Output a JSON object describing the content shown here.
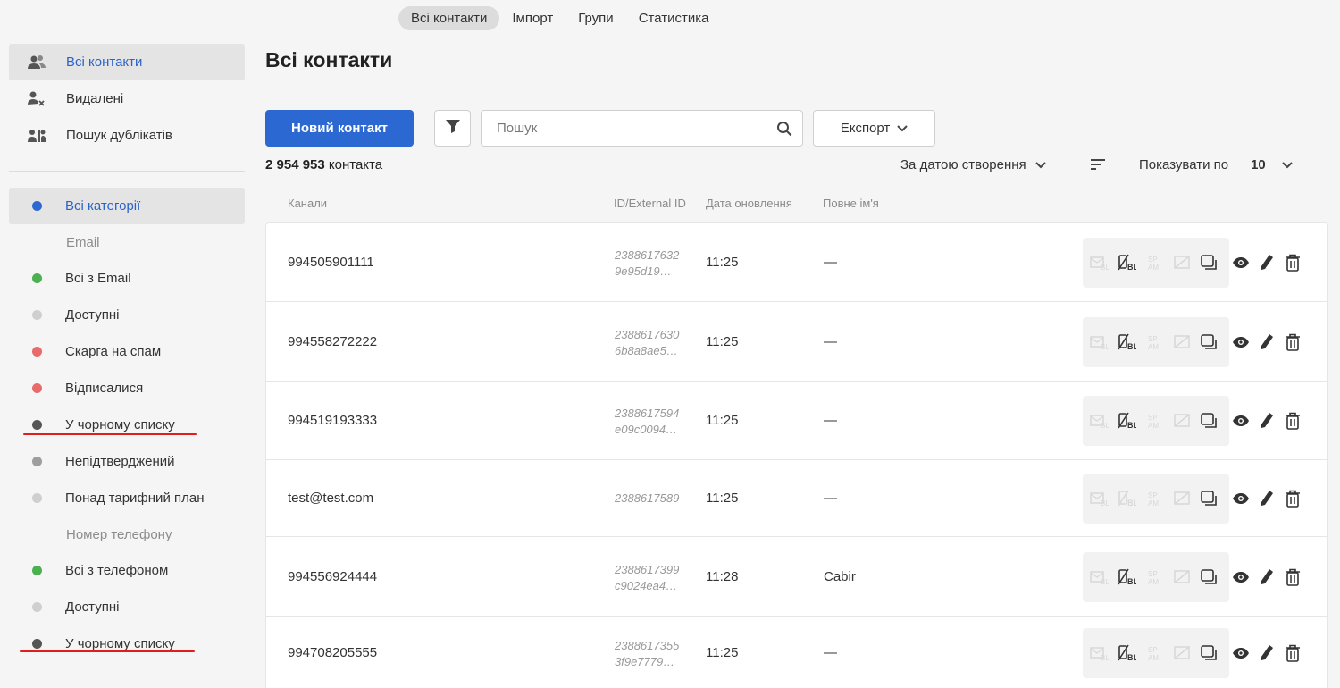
{
  "topnav": [
    "Всі контакти",
    "Імпорт",
    "Групи",
    "Статистика"
  ],
  "sidebar": {
    "top": [
      {
        "label": "Всі контакти",
        "icon": "users-icon"
      },
      {
        "label": "Видалені",
        "icon": "user-remove-icon"
      },
      {
        "label": "Пошук дублікатів",
        "icon": "duplicates-icon"
      }
    ],
    "all_categories": "Всі категорії",
    "email_group": "Email",
    "email_items": [
      {
        "label": "Всі з Email",
        "color": "#4caf50"
      },
      {
        "label": "Доступні",
        "color": "#cfcfcf"
      },
      {
        "label": "Скарга на спам",
        "color": "#e86a6a"
      },
      {
        "label": "Відписалися",
        "color": "#e86a6a"
      },
      {
        "label": "У чорному списку",
        "color": "#555555"
      },
      {
        "label": "Непідтверджений",
        "color": "#9e9e9e"
      },
      {
        "label": "Понад тарифний план",
        "color": "#cfcfcf"
      }
    ],
    "phone_group": "Номер телефону",
    "phone_items": [
      {
        "label": "Всі з телефоном",
        "color": "#4caf50"
      },
      {
        "label": "Доступні",
        "color": "#cfcfcf"
      },
      {
        "label": "У чорному списку",
        "color": "#555555"
      }
    ]
  },
  "page_title": "Всі контакти",
  "new_contact_label": "Новий контакт",
  "search_placeholder": "Пошук",
  "export_label": "Експорт",
  "count_value": "2 954 953",
  "count_suffix": "контакта",
  "sort_label": "За датою створення",
  "per_page_label": "Показувати по",
  "per_page_value": "10",
  "columns": {
    "channels": "Канали",
    "id": "ID/External ID",
    "updated": "Дата оновлення",
    "name": "Повне ім'я"
  },
  "rows": [
    {
      "channel": "994505901111",
      "id1": "2388617632",
      "id2": "9e95d19…",
      "time": "11:25",
      "name": "—"
    },
    {
      "channel": "994558272222",
      "id1": "2388617630",
      "id2": "6b8a8ae5…",
      "time": "11:25",
      "name": "—"
    },
    {
      "channel": "994519193333",
      "id1": "2388617594",
      "id2": "e09c0094…",
      "time": "11:25",
      "name": "—"
    },
    {
      "channel": "test@test.com",
      "id1": "2388617589",
      "id2": "",
      "time": "11:25",
      "name": "—"
    },
    {
      "channel": "994556924444",
      "id1": "2388617399",
      "id2": "c9024ea4…",
      "time": "11:28",
      "name": "Cabir"
    },
    {
      "channel": "994708205555",
      "id1": "2388617355",
      "id2": "3f9e7779…",
      "time": "11:25",
      "name": "—"
    }
  ],
  "accent_color": "#2b68d1",
  "underline_color": "#e01e1e"
}
